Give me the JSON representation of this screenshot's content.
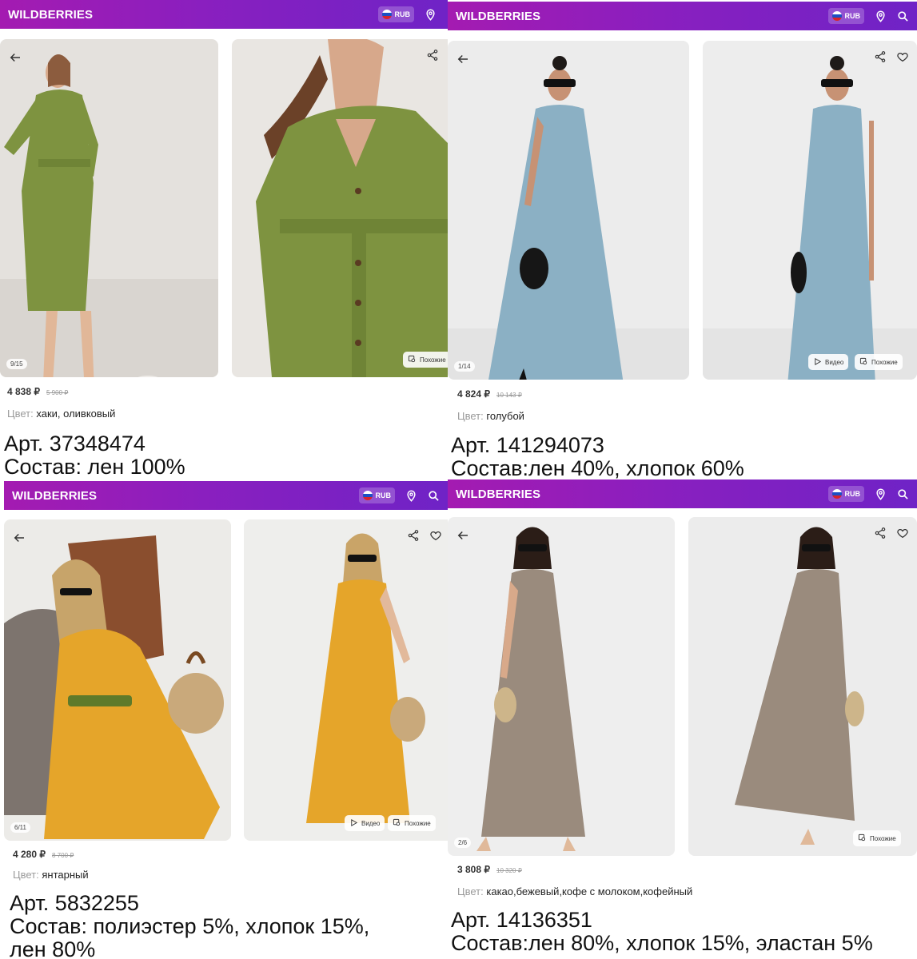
{
  "brand": "WILDBERRIES",
  "currency": "RUB",
  "colors": {
    "header_start": "#a41bb1",
    "header_end": "#6f23c6",
    "price_text": "#333333",
    "muted_text": "#9a9a9a"
  },
  "icons": [
    "back-arrow-icon",
    "share-icon",
    "heart-icon",
    "location-pin-icon",
    "search-icon",
    "play-icon",
    "similar-icon",
    "russia-flag-icon"
  ],
  "listings": [
    {
      "counter": "9/15",
      "price": "4 838 ₽",
      "old_price": "5 900 ₽",
      "color_label": "Цвет:",
      "color_value": "хаки, оливковый",
      "article": "Арт. 37348474",
      "composition_1": "Состав: лен 100%",
      "composition_2": "",
      "similar_label": "Похожие",
      "video_label": ""
    },
    {
      "counter": "1/14",
      "price": "4 824 ₽",
      "old_price": "10 143 ₽",
      "color_label": "Цвет:",
      "color_value": "голубой",
      "article": "Арт. 141294073",
      "composition_1": "Состав:лен 40%, хлопок 60%",
      "composition_2": "",
      "similar_label": "Похожие",
      "video_label": "Видео"
    },
    {
      "counter": "6/11",
      "price": "4 280 ₽",
      "old_price": "8 700 ₽",
      "color_label": "Цвет:",
      "color_value": "янтарный",
      "article": "Арт. 5832255",
      "composition_1": "Состав: полиэстер 5%, хлопок 15%,",
      "composition_2": "лен 80%",
      "similar_label": "Похожие",
      "video_label": "Видео"
    },
    {
      "counter": "2/6",
      "price": "3 808 ₽",
      "old_price": "10 320 ₽",
      "color_label": "Цвет:",
      "color_value": "какао,бежевый,кофе с молоком,кофейный",
      "article": "Арт. 14136351",
      "composition_1": "Состав:лен 80%, хлопок 15%, эластан 5%",
      "composition_2": "",
      "similar_label": "Похожие",
      "video_label": ""
    }
  ]
}
